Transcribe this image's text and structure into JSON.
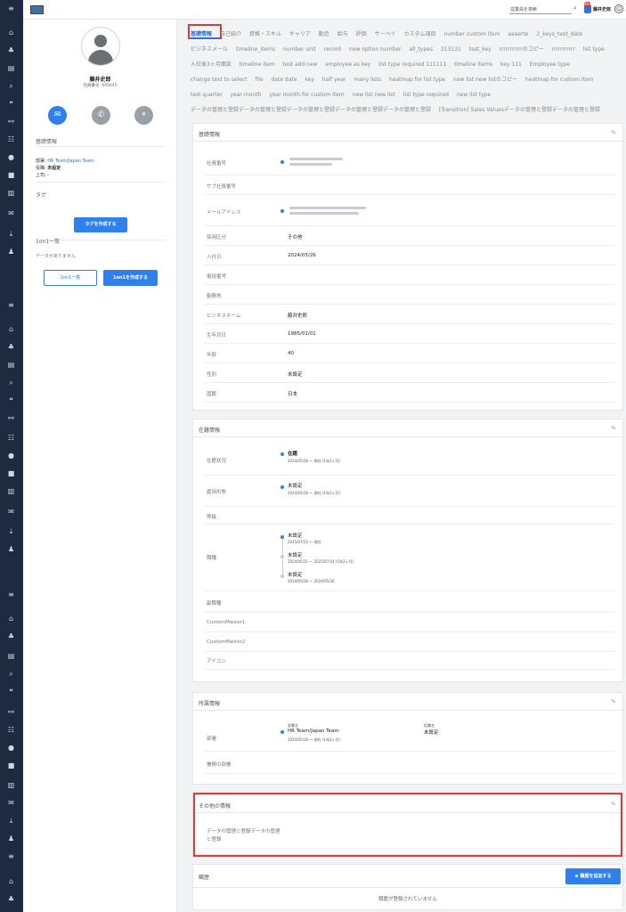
{
  "header": {
    "search_placeholder": "従業員を検索",
    "notification_count": "99+",
    "user_name": "藤井史郎"
  },
  "profile": {
    "name": "藤井史郎",
    "employee_number": "社員番号: 645645",
    "basic_info_label": "基礎情報",
    "department_label": "部署:",
    "department_value": "HR Team/Japan Team",
    "position_label": "役職:",
    "position_value": "未設定",
    "manager_label": "上司:",
    "manager_value": "-",
    "tags_label": "タグ",
    "create_tag_button": "タグを作成する",
    "one_on_one_label": "1on1一覧",
    "no_data_text": "データがありません",
    "one_on_one_list_button": "1on1一覧",
    "create_one_on_one_button": "1on1を作成する"
  },
  "tabs": [
    "基礎情報",
    "自己紹介",
    "資格・スキル",
    "キャリア",
    "勤怠",
    "給与",
    "評価",
    "サーベイ",
    "カスタム項目",
    "number custom item",
    "aaaerte",
    "2_keys_text_date",
    "ビジネスメール",
    "timeline_items",
    "number unit",
    "record",
    "new option number",
    "all_types",
    "313131",
    "test_key",
    "rrrrrrrrrrrのコピー",
    "rrrrrrrrrrr",
    "list type",
    "入社後3ヶ月面談",
    "timeline item",
    "test add new",
    "employee as key",
    "list type required 111111",
    "timeline items",
    "key 111",
    "Employee type",
    "change text to select",
    "file",
    "date date",
    "key",
    "half year",
    "many lists",
    "heatmap for list type",
    "new list new listのコピー",
    "heatmap for custom item",
    "test quarter",
    "year month",
    "year month for custom item",
    "new list new list",
    "list type required",
    "new list type",
    "データの管理と登録データの管理と登録データの管理と登録データの管理と登録データの管理と登録",
    "[Transition] Sales Valuesデータの管理と登録データの管理と登録"
  ],
  "basic_card": {
    "title": "基礎情報",
    "rows": [
      {
        "label": "社員番号",
        "value": ""
      },
      {
        "label": "サブ社員番号",
        "value": ""
      },
      {
        "label": "メールアドレス",
        "value": ""
      },
      {
        "label": "採用区分",
        "value": "その他"
      },
      {
        "label": "入社日",
        "value": "2024/05/26"
      },
      {
        "label": "電話番号",
        "value": ""
      },
      {
        "label": "勤務地",
        "value": ""
      },
      {
        "label": "ビジネスネーム",
        "value": "藤井史郎"
      },
      {
        "label": "生年月日",
        "value": "1985/01/01"
      },
      {
        "label": "年齢",
        "value": "40"
      },
      {
        "label": "性別",
        "value": "未設定"
      },
      {
        "label": "国籍",
        "value": "日本"
      }
    ]
  },
  "status_card": {
    "title": "在籍情報",
    "status_label": "在籍状況",
    "status_value": "在籍",
    "status_period": "2024/05/26 〜 現在 (1年2ヶ月)",
    "employment_label": "雇用形態",
    "employment_value": "未設定",
    "employment_period": "2024/05/26 〜 現在 (1年2ヶ月)",
    "grade_label": "等級",
    "job_label": "職種",
    "job_entries": [
      {
        "title": "未設定",
        "period": "2025/07/25 〜 現在"
      },
      {
        "title": "未設定",
        "period": "2024/05/31 〜 2025/07/24 (1年2ヶ月)"
      },
      {
        "title": "未設定",
        "period": "2024/05/26 〜 2024/05/30"
      }
    ],
    "sub_job_label": "副職種",
    "custom1_label": "CustomMaster1",
    "custom2_label": "CustomMaster2",
    "icon_label": "アイコン"
  },
  "affiliation_card": {
    "title": "所属情報",
    "dept_label": "部署",
    "dept_small": "部署名",
    "dept_value": "HR Team/Japan Team",
    "dept_period": "2024/05/26 〜 現在 (1年2ヶ月)",
    "pos_small": "役職名",
    "pos_value": "未設定",
    "concurrent_label": "兼務の部署"
  },
  "other_card": {
    "title": "その他の情報",
    "row_label_1": "データの管理と登録データの管理",
    "row_label_2": "と登録"
  },
  "history_card": {
    "title": "職歴",
    "add_button": "職歴を追加する",
    "empty_text": "職歴が登録されていません"
  },
  "colors": {
    "accent": "#2f80ed",
    "highlight": "#e53935",
    "sidebar": "#1e2a40"
  }
}
